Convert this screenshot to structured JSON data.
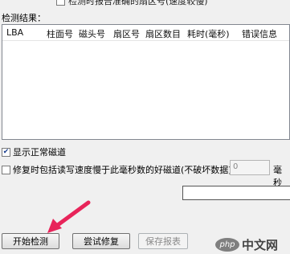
{
  "top_clipped_option": "检测时报告准确的扇区号(速度较慢)",
  "results_label": "检测结果：",
  "columns": [
    "LBA",
    "柱面号",
    "磁头号",
    "扇区号",
    "扇区数目",
    "耗时(毫秒)",
    "错误信息"
  ],
  "show_normal_tracks": {
    "label": "显示正常磁道",
    "checked": true
  },
  "repair_option": {
    "label": "修复时包括读写速度慢于此毫秒数的好磁道(不破坏数据)：",
    "checked": false
  },
  "ms_value": "0",
  "ms_unit": "毫秒",
  "buttons": {
    "start": "开始检测",
    "try_repair": "尝试修复",
    "save_report": "保存报表"
  },
  "watermark": {
    "logo": "php",
    "text": "中文网"
  },
  "colors": {
    "arrow": "#e8245a",
    "list_border": "#828790",
    "background": "#f0f0f0"
  }
}
